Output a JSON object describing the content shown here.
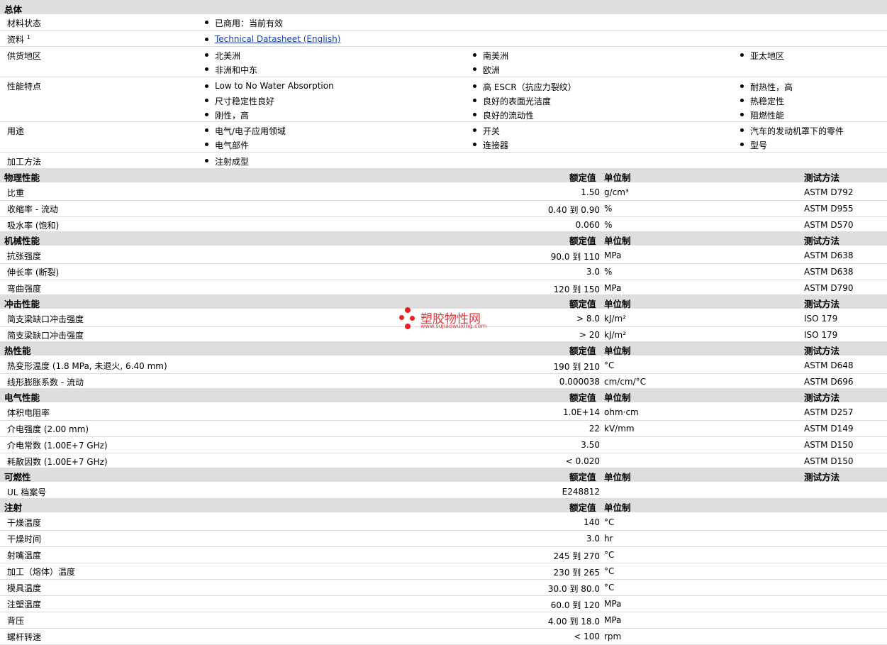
{
  "general": {
    "header": "总体",
    "status_label": "材料状态",
    "status_value": "已商用：当前有效",
    "docs_label": "资料",
    "docs_sup": "1",
    "docs_link": "Technical Datasheet (English)",
    "regions_label": "供货地区",
    "regions": [
      "北美洲",
      "南美洲",
      "亚太地区",
      "非洲和中东",
      "欧洲"
    ],
    "features_label": "性能特点",
    "features": [
      "Low to No Water Absorption",
      "高 ESCR（抗应力裂纹）",
      "耐热性，高",
      "尺寸稳定性良好",
      "良好的表面光洁度",
      "热稳定性",
      "刚性，高",
      "良好的流动性",
      "阻燃性能"
    ],
    "uses_label": "用途",
    "uses": [
      "电气/电子应用领域",
      "开关",
      "汽车的发动机罩下的零件",
      "电气部件",
      "连接器",
      "型号"
    ],
    "process_label": "加工方法",
    "process": [
      "注射成型"
    ]
  },
  "headers": {
    "value": "额定值",
    "unit": "单位制",
    "test": "测试方法"
  },
  "sections": [
    {
      "title": "物理性能",
      "rows": [
        {
          "name": "比重",
          "value": "1.50",
          "unit": "g/cm³",
          "test": "ASTM D792"
        },
        {
          "name": "收缩率 - 流动",
          "value": "0.40 到  0.90",
          "unit": "%",
          "test": "ASTM D955"
        },
        {
          "name": "吸水率 (饱和)",
          "value": "0.060",
          "unit": "%",
          "test": "ASTM D570"
        }
      ]
    },
    {
      "title": "机械性能",
      "rows": [
        {
          "name": "抗张强度",
          "value": "90.0 到  110",
          "unit": "MPa",
          "test": "ASTM D638"
        },
        {
          "name": "伸长率 (断裂)",
          "value": "3.0",
          "unit": "%",
          "test": "ASTM D638"
        },
        {
          "name": "弯曲强度",
          "value": "120 到  150",
          "unit": "MPa",
          "test": "ASTM D790"
        }
      ]
    },
    {
      "title": "冲击性能",
      "rows": [
        {
          "name": "简支梁缺口冲击强度",
          "value": "> 8.0",
          "unit": "kJ/m²",
          "test": "ISO 179"
        },
        {
          "name": "简支梁缺口冲击强度",
          "value": "> 20",
          "unit": "kJ/m²",
          "test": "ISO 179"
        }
      ]
    },
    {
      "title": "热性能",
      "rows": [
        {
          "name": "热变形温度 (1.8 MPa, 未退火, 6.40 mm)",
          "value": "190 到  210",
          "unit": "°C",
          "test": "ASTM D648"
        },
        {
          "name": "线形膨胀系数 - 流动",
          "value": "0.000038",
          "unit": "cm/cm/°C",
          "test": "ASTM D696"
        }
      ]
    },
    {
      "title": "电气性能",
      "rows": [
        {
          "name": "体积电阻率",
          "value": "1.0E+14",
          "unit": "ohm·cm",
          "test": "ASTM D257"
        },
        {
          "name": "介电强度 (2.00 mm)",
          "value": "22",
          "unit": "kV/mm",
          "test": "ASTM D149"
        },
        {
          "name": "介电常数 (1.00E+7 GHz)",
          "value": "3.50",
          "unit": "",
          "test": "ASTM D150"
        },
        {
          "name": "耗散因数 (1.00E+7 GHz)",
          "value": "< 0.020",
          "unit": "",
          "test": "ASTM D150"
        }
      ]
    },
    {
      "title": "可燃性",
      "rows": [
        {
          "name": "UL 档案号",
          "value": "E248812",
          "unit": "",
          "test": ""
        }
      ]
    },
    {
      "title": "注射",
      "no_test": true,
      "rows": [
        {
          "name": "干燥温度",
          "value": "140",
          "unit": "°C",
          "test": ""
        },
        {
          "name": "干燥时间",
          "value": "3.0",
          "unit": "hr",
          "test": ""
        },
        {
          "name": "射嘴温度",
          "value": "245 到  270",
          "unit": "°C",
          "test": ""
        },
        {
          "name": "加工（熔体）温度",
          "value": "230 到  265",
          "unit": "°C",
          "test": ""
        },
        {
          "name": "模具温度",
          "value": "30.0 到  80.0",
          "unit": "°C",
          "test": ""
        },
        {
          "name": "注塑温度",
          "value": "60.0 到  120",
          "unit": "MPa",
          "test": ""
        },
        {
          "name": "背压",
          "value": "4.00 到  18.0",
          "unit": "MPa",
          "test": ""
        },
        {
          "name": "螺杆转速",
          "value": "< 100",
          "unit": "rpm",
          "test": ""
        }
      ]
    }
  ],
  "watermark": {
    "cn": "塑胶物性网",
    "en": "www.sujiaowuxing.com",
    "color": "#ee1c24"
  }
}
